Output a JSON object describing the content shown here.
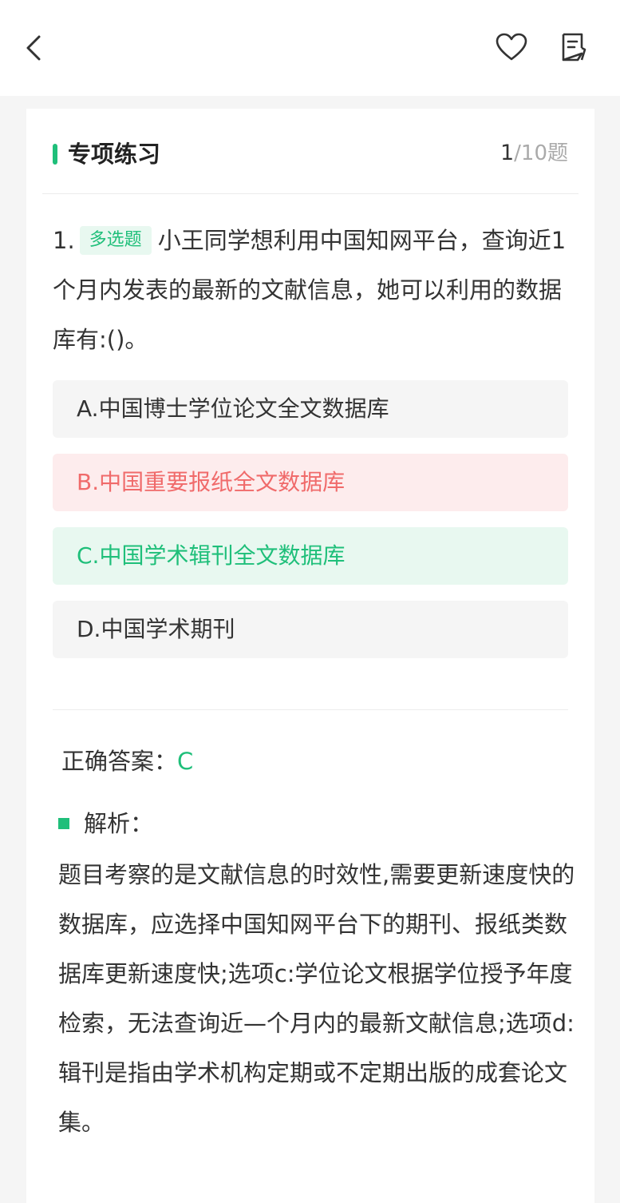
{
  "header": {
    "back_icon": "chevron-left-icon",
    "favorite_icon": "heart-icon",
    "notes_icon": "notes-icon"
  },
  "section": {
    "title": "专项练习",
    "current": "1",
    "total": "/10题"
  },
  "question": {
    "number": "1.",
    "type_tag": "多选题",
    "text": "小王同学想利用中国知网平台，查询近1个月内发表的最新的文献信息，她可以利用的数据库有:()。"
  },
  "options": [
    {
      "label": "A.中国博士学位论文全文数据库",
      "state": "normal"
    },
    {
      "label": "B.中国重要报纸全文数据库",
      "state": "wrong"
    },
    {
      "label": "C.中国学术辑刊全文数据库",
      "state": "correct"
    },
    {
      "label": "D.中国学术期刊",
      "state": "normal"
    }
  ],
  "answer": {
    "label": "正确答案：",
    "value": "C"
  },
  "analysis": {
    "title": "解析：",
    "text": "题目考察的是文献信息的时效性,需要更新速度快的数据库，应选择中国知网平台下的期刊、报纸类数据库更新速度快;选项c:学位论文根据学位授予年度检索，无法查询近—个月内的最新文献信息;选项d:辑刊是指由学术机构定期或不定期出版的成套论文集。"
  },
  "colors": {
    "accent": "#1fbf7a",
    "wrong": "#f06a6a",
    "correct_bg": "#e8f8f0",
    "wrong_bg": "#fdeced"
  }
}
